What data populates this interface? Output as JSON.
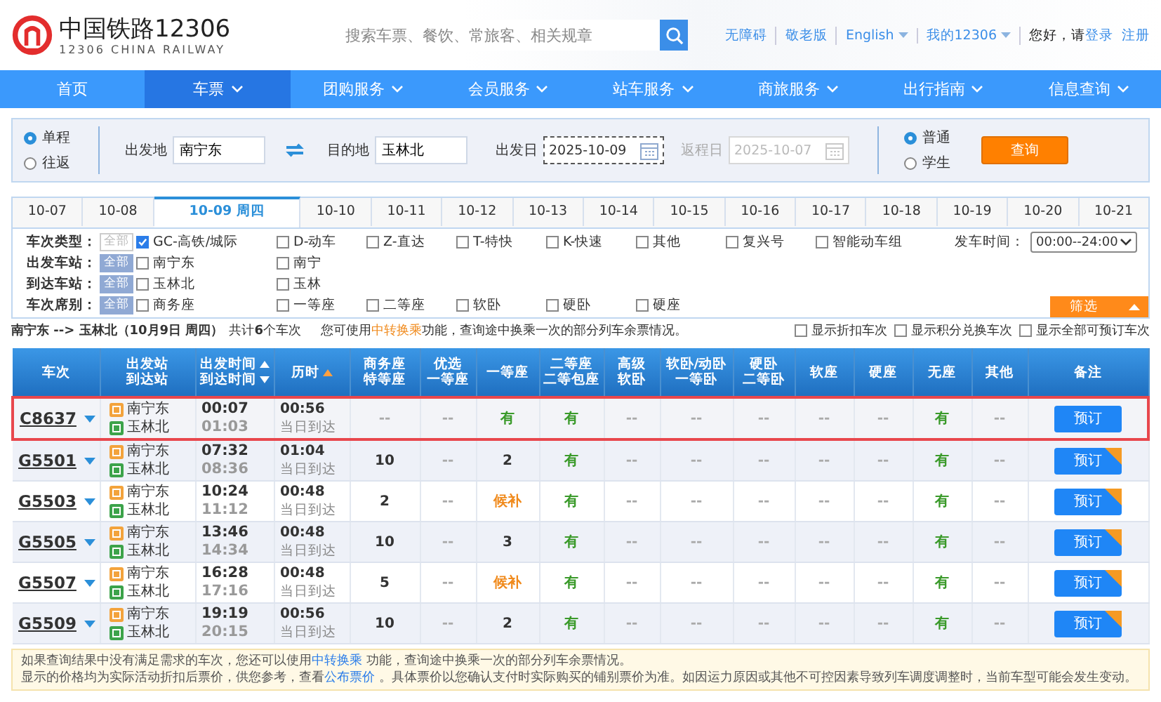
{
  "header": {
    "logo_title": "中国铁路12306",
    "logo_subtitle": "12306 CHINA RAILWAY",
    "search": {
      "placeholder": "搜索车票、餐饮、常旅客、相关规章"
    },
    "links": [
      {
        "label": "无障碍",
        "menu": false
      },
      {
        "label": "敬老版",
        "menu": false
      },
      {
        "label": "English",
        "menu": true
      },
      {
        "label": "我的12306",
        "menu": true
      }
    ],
    "greeting": "您好，请",
    "login": "登录",
    "register": "注册"
  },
  "nav": [
    {
      "label": "首页",
      "selected": false,
      "menu": false
    },
    {
      "label": "车票",
      "selected": true,
      "menu": true
    },
    {
      "label": "团购服务",
      "selected": false,
      "menu": true
    },
    {
      "label": "会员服务",
      "selected": false,
      "menu": true
    },
    {
      "label": "站车服务",
      "selected": false,
      "menu": true
    },
    {
      "label": "商旅服务",
      "selected": false,
      "menu": true
    },
    {
      "label": "出行指南",
      "selected": false,
      "menu": true
    },
    {
      "label": "信息查询",
      "selected": false,
      "menu": true
    }
  ],
  "query": {
    "trip_types": [
      {
        "label": "单程",
        "selected": true
      },
      {
        "label": "往返",
        "selected": false
      }
    ],
    "from": {
      "label": "出发地",
      "value": "南宁东"
    },
    "to": {
      "label": "目的地",
      "value": "玉林北"
    },
    "depart_date": {
      "label": "出发日",
      "value": "2025-10-09",
      "disabled": false
    },
    "return_date": {
      "label": "返程日",
      "value": "2025-10-07",
      "disabled": true
    },
    "passenger_types": [
      {
        "label": "普通",
        "selected": true
      },
      {
        "label": "学生",
        "selected": false
      }
    ],
    "button": "查询"
  },
  "date_tabs": [
    {
      "label": "10-07",
      "selected": false
    },
    {
      "label": "10-08",
      "selected": false
    },
    {
      "label": "10-09 周四",
      "selected": true
    },
    {
      "label": "10-10",
      "selected": false
    },
    {
      "label": "10-11",
      "selected": false
    },
    {
      "label": "10-12",
      "selected": false
    },
    {
      "label": "10-13",
      "selected": false
    },
    {
      "label": "10-14",
      "selected": false
    },
    {
      "label": "10-15",
      "selected": false
    },
    {
      "label": "10-16",
      "selected": false
    },
    {
      "label": "10-17",
      "selected": false
    },
    {
      "label": "10-18",
      "selected": false
    },
    {
      "label": "10-19",
      "selected": false
    },
    {
      "label": "10-20",
      "selected": false
    },
    {
      "label": "10-21",
      "selected": false
    }
  ],
  "filters": [
    {
      "label": "车次类型：",
      "all": "全部",
      "all_selected": false,
      "options": [
        {
          "label": "GC-高铁/城际",
          "checked": true
        },
        {
          "label": "D-动车",
          "checked": false
        },
        {
          "label": "Z-直达",
          "checked": false
        },
        {
          "label": "T-特快",
          "checked": false
        },
        {
          "label": "K-快速",
          "checked": false
        },
        {
          "label": "其他",
          "checked": false
        },
        {
          "label": "复兴号",
          "checked": false
        },
        {
          "label": "智能动车组",
          "checked": false
        }
      ]
    },
    {
      "label": "出发车站：",
      "all": "全部",
      "all_selected": true,
      "options": [
        {
          "label": "南宁东",
          "checked": false
        },
        {
          "label": "南宁",
          "checked": false
        }
      ]
    },
    {
      "label": "到达车站：",
      "all": "全部",
      "all_selected": true,
      "options": [
        {
          "label": "玉林北",
          "checked": false
        },
        {
          "label": "玉林",
          "checked": false
        }
      ]
    },
    {
      "label": "车次席别：",
      "all": "全部",
      "all_selected": true,
      "options": [
        {
          "label": "商务座",
          "checked": false
        },
        {
          "label": "一等座",
          "checked": false
        },
        {
          "label": "二等座",
          "checked": false
        },
        {
          "label": "软卧",
          "checked": false
        },
        {
          "label": "硬卧",
          "checked": false
        },
        {
          "label": "硬座",
          "checked": false
        }
      ]
    }
  ],
  "depart_time": {
    "label": "发车时间：",
    "value": "00:00--24:00"
  },
  "filter_button": "筛选",
  "summary": {
    "route": "南宁东 --> 玉林北（10月9日  周四）",
    "count": "共计**6**个车次",
    "note_before": "您可使用",
    "note_link": "中转换乘",
    "note_after": "功能，查询途中换乘一次的部分列车余票情况。",
    "options": [
      {
        "label": "显示折扣车次",
        "checked": false
      },
      {
        "label": "显示积分兑换车次",
        "checked": false
      },
      {
        "label": "显示全部可预订车次",
        "checked": false
      }
    ]
  },
  "table": {
    "columns": [
      {
        "lines": [
          "车次"
        ],
        "kind": "plain"
      },
      {
        "lines": [
          "出发站",
          "到达站"
        ],
        "kind": "plain"
      },
      {
        "lines": [
          "出发时间",
          "到达时间"
        ],
        "kind": "time"
      },
      {
        "lines": [
          "历时"
        ],
        "kind": "duration"
      },
      {
        "lines": [
          "商务座",
          "特等座"
        ],
        "kind": "plain"
      },
      {
        "lines": [
          "优选",
          "一等座"
        ],
        "kind": "plain"
      },
      {
        "lines": [
          "一等座"
        ],
        "kind": "plain"
      },
      {
        "lines": [
          "二等座",
          "二等包座"
        ],
        "kind": "plain"
      },
      {
        "lines": [
          "高级",
          "软卧"
        ],
        "kind": "plain"
      },
      {
        "lines": [
          "软卧/动卧",
          "一等卧"
        ],
        "kind": "plain"
      },
      {
        "lines": [
          "硬卧",
          "二等卧"
        ],
        "kind": "plain"
      },
      {
        "lines": [
          "软座"
        ],
        "kind": "plain"
      },
      {
        "lines": [
          "硬座"
        ],
        "kind": "plain"
      },
      {
        "lines": [
          "无座"
        ],
        "kind": "plain"
      },
      {
        "lines": [
          "其他"
        ],
        "kind": "plain"
      },
      {
        "lines": [
          "备注"
        ],
        "kind": "plain"
      }
    ],
    "rows": [
      {
        "train": "C8637",
        "from": "南宁东",
        "to": "玉林北",
        "depart": "00:07",
        "arrive": "01:03",
        "duration": "00:56",
        "arrival_day": "当日到达",
        "highlighted": true,
        "badge": false,
        "button": "预订",
        "seats": [
          {
            "text": "--",
            "kind": "none"
          },
          {
            "text": "--",
            "kind": "none"
          },
          {
            "text": "有",
            "kind": "available"
          },
          {
            "text": "有",
            "kind": "available"
          },
          {
            "text": "--",
            "kind": "none"
          },
          {
            "text": "--",
            "kind": "none"
          },
          {
            "text": "--",
            "kind": "none"
          },
          {
            "text": "--",
            "kind": "none"
          },
          {
            "text": "--",
            "kind": "none"
          },
          {
            "text": "有",
            "kind": "available"
          },
          {
            "text": "--",
            "kind": "none"
          }
        ]
      },
      {
        "train": "G5501",
        "from": "南宁东",
        "to": "玉林北",
        "depart": "07:32",
        "arrive": "08:36",
        "duration": "01:04",
        "arrival_day": "当日到达",
        "highlighted": false,
        "badge": true,
        "button": "预订",
        "seats": [
          {
            "text": "10",
            "kind": "count"
          },
          {
            "text": "--",
            "kind": "none"
          },
          {
            "text": "2",
            "kind": "count"
          },
          {
            "text": "有",
            "kind": "available"
          },
          {
            "text": "--",
            "kind": "none"
          },
          {
            "text": "--",
            "kind": "none"
          },
          {
            "text": "--",
            "kind": "none"
          },
          {
            "text": "--",
            "kind": "none"
          },
          {
            "text": "--",
            "kind": "none"
          },
          {
            "text": "有",
            "kind": "available"
          },
          {
            "text": "--",
            "kind": "none"
          }
        ]
      },
      {
        "train": "G5503",
        "from": "南宁东",
        "to": "玉林北",
        "depart": "10:24",
        "arrive": "11:12",
        "duration": "00:48",
        "arrival_day": "当日到达",
        "highlighted": false,
        "badge": true,
        "button": "预订",
        "seats": [
          {
            "text": "2",
            "kind": "count"
          },
          {
            "text": "--",
            "kind": "none"
          },
          {
            "text": "候补",
            "kind": "waitlist"
          },
          {
            "text": "有",
            "kind": "available"
          },
          {
            "text": "--",
            "kind": "none"
          },
          {
            "text": "--",
            "kind": "none"
          },
          {
            "text": "--",
            "kind": "none"
          },
          {
            "text": "--",
            "kind": "none"
          },
          {
            "text": "--",
            "kind": "none"
          },
          {
            "text": "有",
            "kind": "available"
          },
          {
            "text": "--",
            "kind": "none"
          }
        ]
      },
      {
        "train": "G5505",
        "from": "南宁东",
        "to": "玉林北",
        "depart": "13:46",
        "arrive": "14:34",
        "duration": "00:48",
        "arrival_day": "当日到达",
        "highlighted": false,
        "badge": true,
        "button": "预订",
        "seats": [
          {
            "text": "10",
            "kind": "count"
          },
          {
            "text": "--",
            "kind": "none"
          },
          {
            "text": "3",
            "kind": "count"
          },
          {
            "text": "有",
            "kind": "available"
          },
          {
            "text": "--",
            "kind": "none"
          },
          {
            "text": "--",
            "kind": "none"
          },
          {
            "text": "--",
            "kind": "none"
          },
          {
            "text": "--",
            "kind": "none"
          },
          {
            "text": "--",
            "kind": "none"
          },
          {
            "text": "有",
            "kind": "available"
          },
          {
            "text": "--",
            "kind": "none"
          }
        ]
      },
      {
        "train": "G5507",
        "from": "南宁东",
        "to": "玉林北",
        "depart": "16:28",
        "arrive": "17:16",
        "duration": "00:48",
        "arrival_day": "当日到达",
        "highlighted": false,
        "badge": true,
        "button": "预订",
        "seats": [
          {
            "text": "5",
            "kind": "count"
          },
          {
            "text": "--",
            "kind": "none"
          },
          {
            "text": "候补",
            "kind": "waitlist"
          },
          {
            "text": "有",
            "kind": "available"
          },
          {
            "text": "--",
            "kind": "none"
          },
          {
            "text": "--",
            "kind": "none"
          },
          {
            "text": "--",
            "kind": "none"
          },
          {
            "text": "--",
            "kind": "none"
          },
          {
            "text": "--",
            "kind": "none"
          },
          {
            "text": "有",
            "kind": "available"
          },
          {
            "text": "--",
            "kind": "none"
          }
        ]
      },
      {
        "train": "G5509",
        "from": "南宁东",
        "to": "玉林北",
        "depart": "19:19",
        "arrive": "20:15",
        "duration": "00:56",
        "arrival_day": "当日到达",
        "highlighted": false,
        "badge": true,
        "button": "预订",
        "seats": [
          {
            "text": "10",
            "kind": "count"
          },
          {
            "text": "--",
            "kind": "none"
          },
          {
            "text": "2",
            "kind": "count"
          },
          {
            "text": "有",
            "kind": "available"
          },
          {
            "text": "--",
            "kind": "none"
          },
          {
            "text": "--",
            "kind": "none"
          },
          {
            "text": "--",
            "kind": "none"
          },
          {
            "text": "--",
            "kind": "none"
          },
          {
            "text": "--",
            "kind": "none"
          },
          {
            "text": "有",
            "kind": "available"
          },
          {
            "text": "--",
            "kind": "none"
          }
        ]
      }
    ]
  },
  "notes": [
    {
      "before": "如果查询结果中没有满足需求的车次，您还可以使用",
      "link": "中转换乘",
      "after": " 功能，查询途中换乘一次的部分列车余票情况。"
    },
    {
      "before": "显示的价格均为实际活动折扣后票价，供您参考，查看",
      "link": "公布票价",
      "after": " 。具体票价以您确认支付时实际购买的铺别票价为准。如因运力原因或其他不可控因素导致列车调度调整时，当前车型可能会发生变动。"
    }
  ]
}
